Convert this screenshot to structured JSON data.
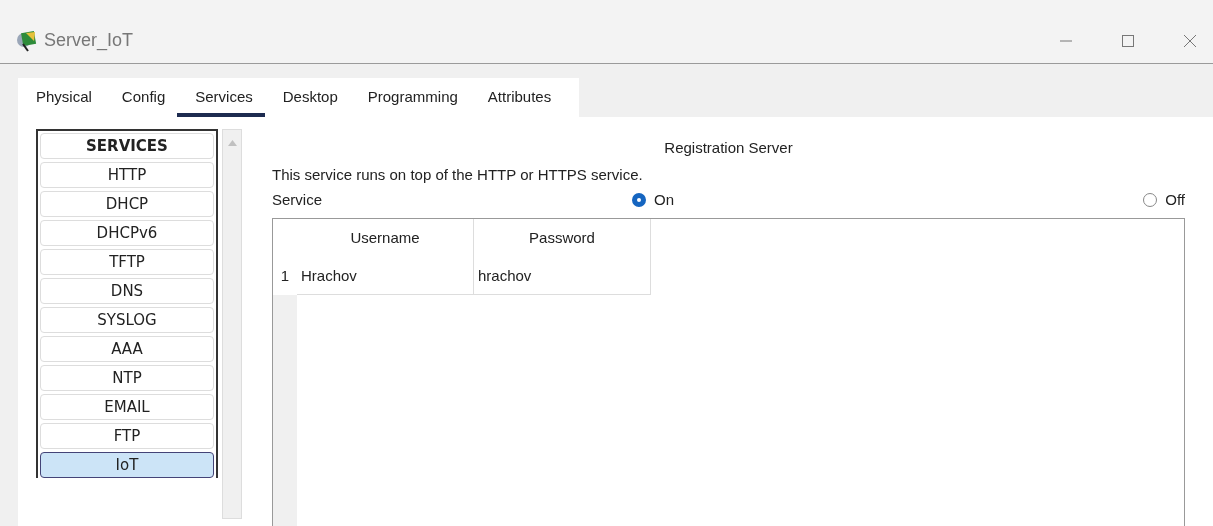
{
  "window": {
    "title": "Server_IoT"
  },
  "tabs": [
    {
      "label": "Physical",
      "selected": false
    },
    {
      "label": "Config",
      "selected": false
    },
    {
      "label": "Services",
      "selected": true
    },
    {
      "label": "Desktop",
      "selected": false
    },
    {
      "label": "Programming",
      "selected": false
    },
    {
      "label": "Attributes",
      "selected": false
    }
  ],
  "sidebar": {
    "heading": "SERVICES",
    "items": [
      {
        "label": "HTTP",
        "selected": false
      },
      {
        "label": "DHCP",
        "selected": false
      },
      {
        "label": "DHCPv6",
        "selected": false
      },
      {
        "label": "TFTP",
        "selected": false
      },
      {
        "label": "DNS",
        "selected": false
      },
      {
        "label": "SYSLOG",
        "selected": false
      },
      {
        "label": "AAA",
        "selected": false
      },
      {
        "label": "NTP",
        "selected": false
      },
      {
        "label": "EMAIL",
        "selected": false
      },
      {
        "label": "FTP",
        "selected": false
      },
      {
        "label": "IoT",
        "selected": true
      }
    ]
  },
  "panel": {
    "title": "Registration Server",
    "description": "This service runs on top of the HTTP or HTTPS service.",
    "service_label": "Service",
    "options": [
      {
        "label": "On",
        "selected": true
      },
      {
        "label": "Off",
        "selected": false
      }
    ]
  },
  "table": {
    "columns": [
      "Username",
      "Password"
    ],
    "rows": [
      {
        "number": "1",
        "cells": [
          "Hrachov",
          "hrachov"
        ]
      }
    ]
  }
}
